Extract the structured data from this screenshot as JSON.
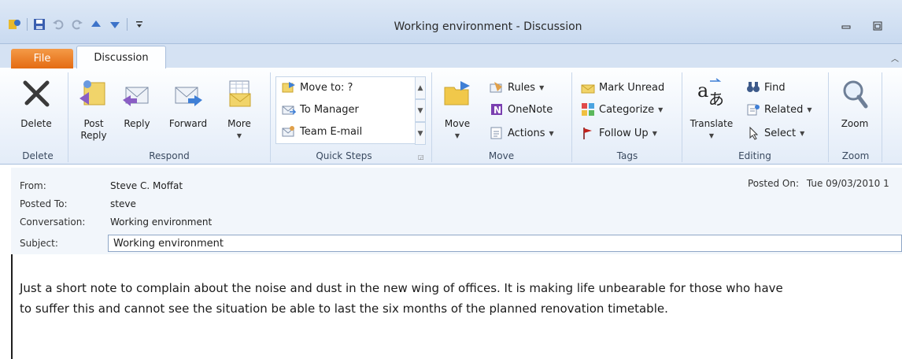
{
  "window": {
    "title": "Working environment - Discussion"
  },
  "tabs": {
    "file": "File",
    "discussion": "Discussion"
  },
  "ribbon": {
    "delete_group": {
      "label": "Delete",
      "delete_btn": "Delete"
    },
    "respond_group": {
      "label": "Respond",
      "post_reply_line1": "Post",
      "post_reply_line2": "Reply",
      "reply": "Reply",
      "forward": "Forward",
      "more": "More"
    },
    "quick_steps_group": {
      "label": "Quick Steps",
      "items": [
        "Move to: ?",
        "To Manager",
        "Team E-mail"
      ]
    },
    "move_group": {
      "label": "Move",
      "move": "Move",
      "rules": "Rules",
      "onenote": "OneNote",
      "actions": "Actions"
    },
    "tags_group": {
      "label": "Tags",
      "mark_unread": "Mark Unread",
      "categorize": "Categorize",
      "follow_up": "Follow Up"
    },
    "editing_group": {
      "label": "Editing",
      "translate": "Translate",
      "find": "Find",
      "related": "Related",
      "select": "Select"
    },
    "zoom_group": {
      "label": "Zoom",
      "zoom": "Zoom"
    }
  },
  "message": {
    "from_label": "From:",
    "from_value": "Steve C. Moffat",
    "posted_to_label": "Posted To:",
    "posted_to_value": "steve",
    "conversation_label": "Conversation:",
    "conversation_value": "Working environment",
    "subject_label": "Subject:",
    "subject_value": "Working environment",
    "posted_on_label": "Posted On:",
    "posted_on_value": "Tue 09/03/2010 1",
    "body_line1": "Just a short note to complain about the noise and dust in the new wing of offices. It is making life unbearable for those who have",
    "body_line2": "to suffer this and cannot see the situation be able to last the six months of the planned renovation timetable."
  }
}
